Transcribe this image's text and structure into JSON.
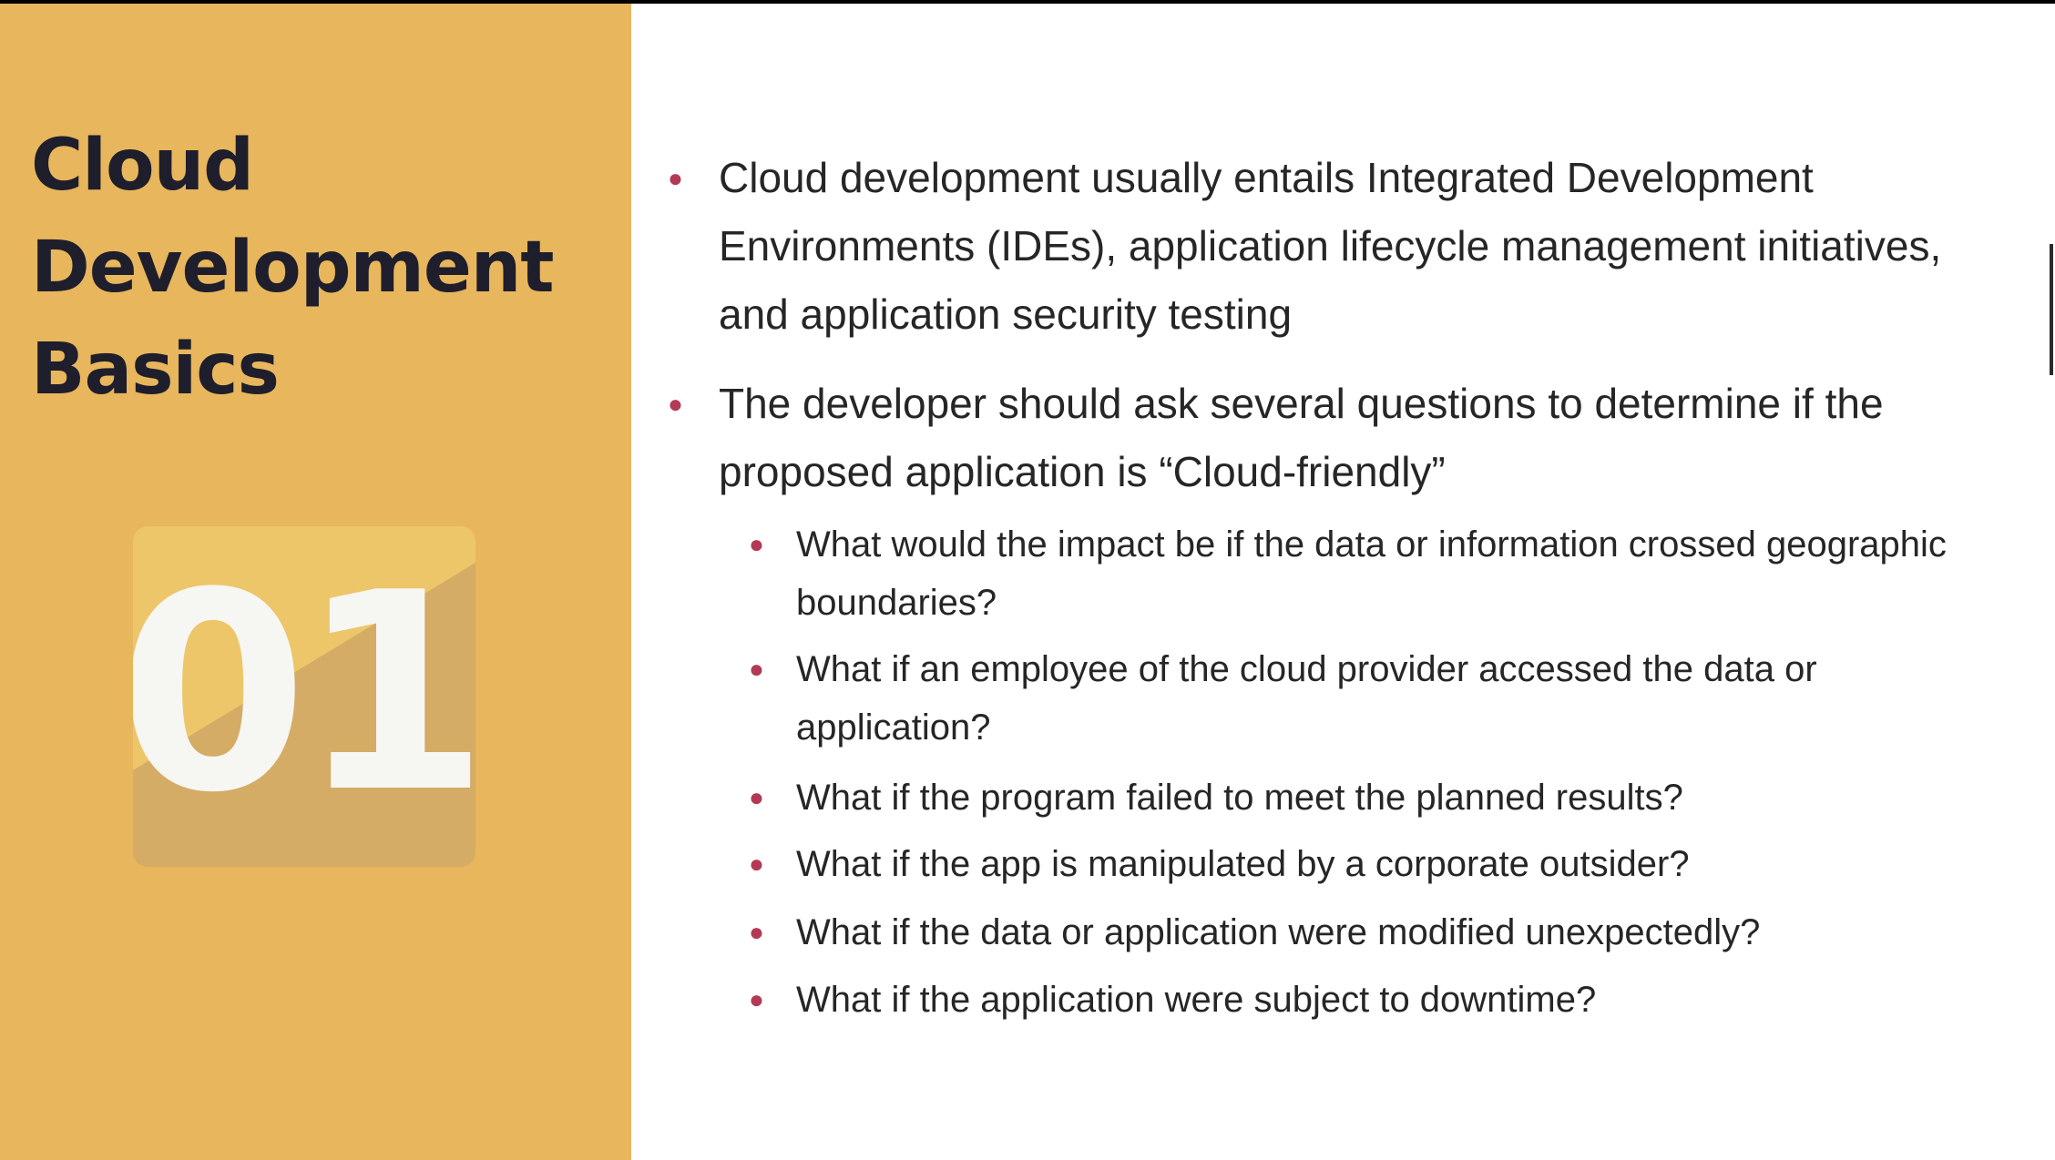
{
  "slide": {
    "title_lines": [
      "Cloud",
      "Development",
      "Basics"
    ],
    "number": "01",
    "colors": {
      "left_panel": "#E8B65C",
      "title_text": "#1E1E2C",
      "badge_light": "#EDC66A",
      "badge_dark": "#D4AC66",
      "number_text": "#F6F6F2",
      "bullet_dot": "#B23A55",
      "body_text": "#262626",
      "background": "#FFFFFF"
    },
    "bullets": [
      {
        "text": "Cloud development usually entails Integrated Development Environments (IDEs), application lifecycle management initiatives, and application security testing"
      },
      {
        "text": "The developer should ask several questions to determine if the proposed application is “Cloud-friendly”"
      }
    ],
    "sub_bullets": [
      {
        "text": "What would the impact be if the data or information crossed geographic boundaries?"
      },
      {
        "text": "What if an employee of the cloud provider accessed the data or application?"
      },
      {
        "text": "What if the program failed to meet the planned results?"
      },
      {
        "text": "What if the app is manipulated by a corporate outsider?"
      },
      {
        "text": "What if the data or application were modified unexpectedly?"
      },
      {
        "text": "What if the application were subject to downtime?"
      }
    ]
  }
}
